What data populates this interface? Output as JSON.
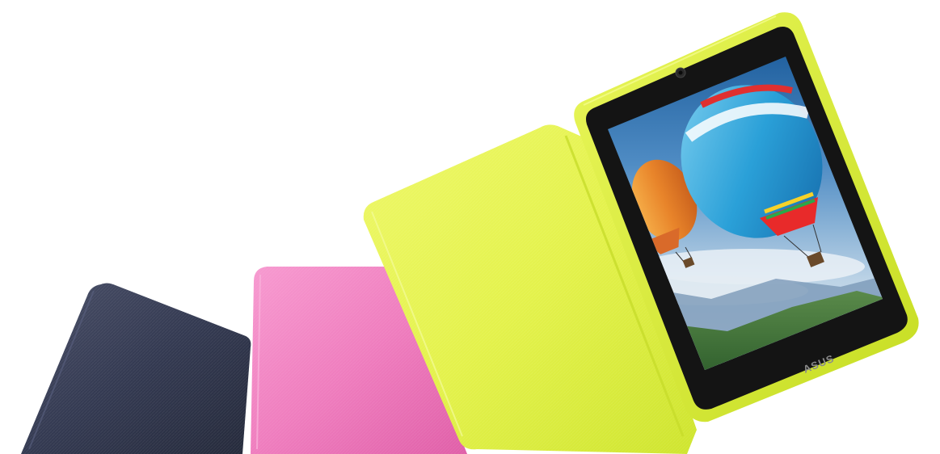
{
  "scene": {
    "description_colors": {
      "navy_cover": "#2f3448",
      "pink_cover": "#f27dbd",
      "lime_cover": "#e3f24a",
      "lime_bumper": "#d6ec2f",
      "bezel": "#151515",
      "sky_top": "#2a6fb0",
      "sky_bottom": "#d9e6f0",
      "mountain": "#3e7a3a"
    },
    "tablet": {
      "brand_logo": "ASUS"
    }
  }
}
